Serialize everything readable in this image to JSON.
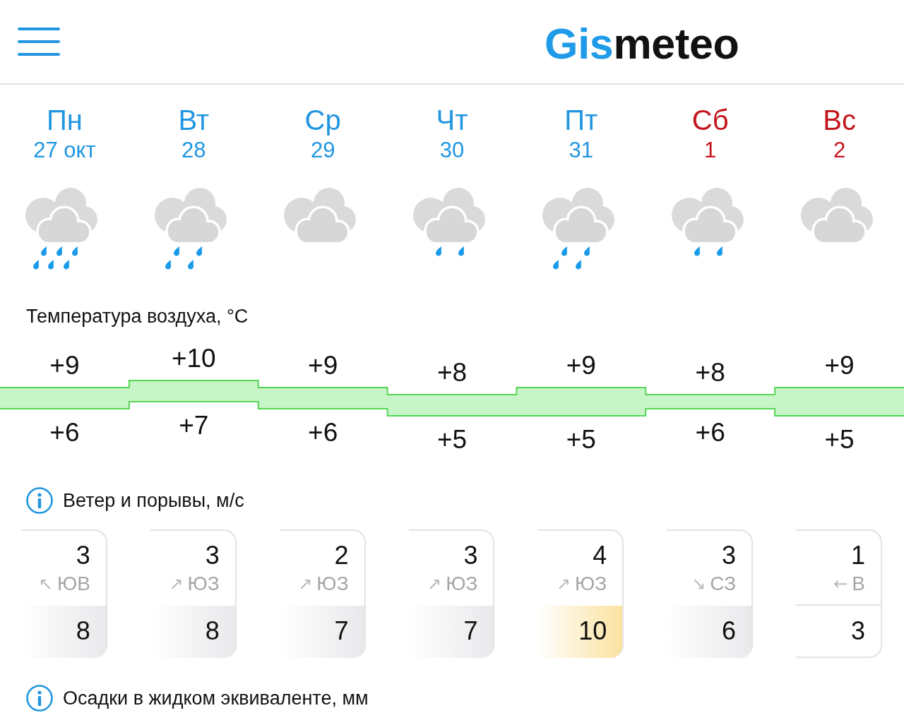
{
  "header": {
    "logo": {
      "accent": "Gis",
      "rest": "meteo"
    }
  },
  "days": [
    {
      "name": "Пн",
      "date": "27 окт",
      "weekend": false,
      "kind": "heavy-rain"
    },
    {
      "name": "Вт",
      "date": "28",
      "weekend": false,
      "kind": "rain"
    },
    {
      "name": "Ср",
      "date": "29",
      "weekend": false,
      "kind": "overcast"
    },
    {
      "name": "Чт",
      "date": "30",
      "weekend": false,
      "kind": "light-rain"
    },
    {
      "name": "Пт",
      "date": "31",
      "weekend": false,
      "kind": "rain"
    },
    {
      "name": "Сб",
      "date": "1",
      "weekend": true,
      "kind": "light-rain"
    },
    {
      "name": "Вс",
      "date": "2",
      "weekend": true,
      "kind": "overcast"
    }
  ],
  "temperature": {
    "title": "Температура воздуха, °C",
    "info": false,
    "days": [
      {
        "max": "+9",
        "min": "+6"
      },
      {
        "max": "+10",
        "min": "+7"
      },
      {
        "max": "+9",
        "min": "+6"
      },
      {
        "max": "+8",
        "min": "+5"
      },
      {
        "max": "+9",
        "min": "+5"
      },
      {
        "max": "+8",
        "min": "+6"
      },
      {
        "max": "+9",
        "min": "+5"
      }
    ]
  },
  "wind": {
    "title": "Ветер и порывы, м/с",
    "info": true,
    "cards": [
      {
        "speed": "3",
        "arrow": "↖",
        "direction": "ЮВ",
        "gust": "8",
        "kind": "moderate"
      },
      {
        "speed": "3",
        "arrow": "↗",
        "direction": "ЮЗ",
        "gust": "8",
        "kind": "moderate"
      },
      {
        "speed": "2",
        "arrow": "↗",
        "direction": "ЮЗ",
        "gust": "7",
        "kind": "moderate"
      },
      {
        "speed": "3",
        "arrow": "↗",
        "direction": "ЮЗ",
        "gust": "7",
        "kind": "moderate"
      },
      {
        "speed": "4",
        "arrow": "↗",
        "direction": "ЮЗ",
        "gust": "10",
        "kind": "strong"
      },
      {
        "speed": "3",
        "arrow": "↘",
        "direction": "СЗ",
        "gust": "6",
        "kind": "moderate"
      },
      {
        "speed": "1",
        "arrow": "←",
        "direction": "В",
        "gust": "3",
        "kind": "weak"
      }
    ]
  },
  "precipitation": {
    "title": "Осадки в жидком эквиваленте, мм",
    "info": true
  }
}
